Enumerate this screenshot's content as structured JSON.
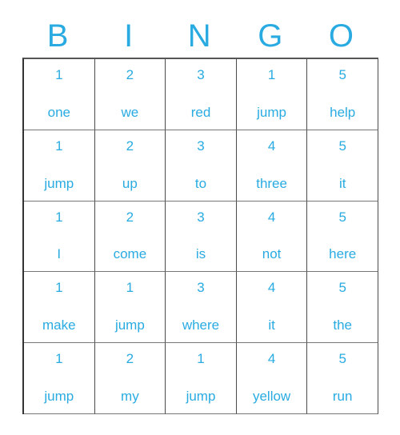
{
  "card": {
    "accent_color": "#29abe2",
    "border_color": "#4a4a4a",
    "background_color": "#ffffff",
    "headers": [
      {
        "letter": "B"
      },
      {
        "letter": "I"
      },
      {
        "letter": "N"
      },
      {
        "letter": "G"
      },
      {
        "letter": "O"
      }
    ],
    "rows": [
      [
        {
          "number": "1",
          "word": "one"
        },
        {
          "number": "2",
          "word": "we"
        },
        {
          "number": "3",
          "word": "red"
        },
        {
          "number": "1",
          "word": "jump"
        },
        {
          "number": "5",
          "word": "help"
        }
      ],
      [
        {
          "number": "1",
          "word": "jump"
        },
        {
          "number": "2",
          "word": "up"
        },
        {
          "number": "3",
          "word": "to"
        },
        {
          "number": "4",
          "word": "three"
        },
        {
          "number": "5",
          "word": "it"
        }
      ],
      [
        {
          "number": "1",
          "word": "I"
        },
        {
          "number": "2",
          "word": "come"
        },
        {
          "number": "3",
          "word": "is"
        },
        {
          "number": "4",
          "word": "not"
        },
        {
          "number": "5",
          "word": "here"
        }
      ],
      [
        {
          "number": "1",
          "word": "make"
        },
        {
          "number": "1",
          "word": "jump"
        },
        {
          "number": "3",
          "word": "where"
        },
        {
          "number": "4",
          "word": "it"
        },
        {
          "number": "5",
          "word": "the"
        }
      ],
      [
        {
          "number": "1",
          "word": "jump"
        },
        {
          "number": "2",
          "word": "my"
        },
        {
          "number": "1",
          "word": "jump"
        },
        {
          "number": "4",
          "word": "yellow"
        },
        {
          "number": "5",
          "word": "run"
        }
      ]
    ]
  }
}
